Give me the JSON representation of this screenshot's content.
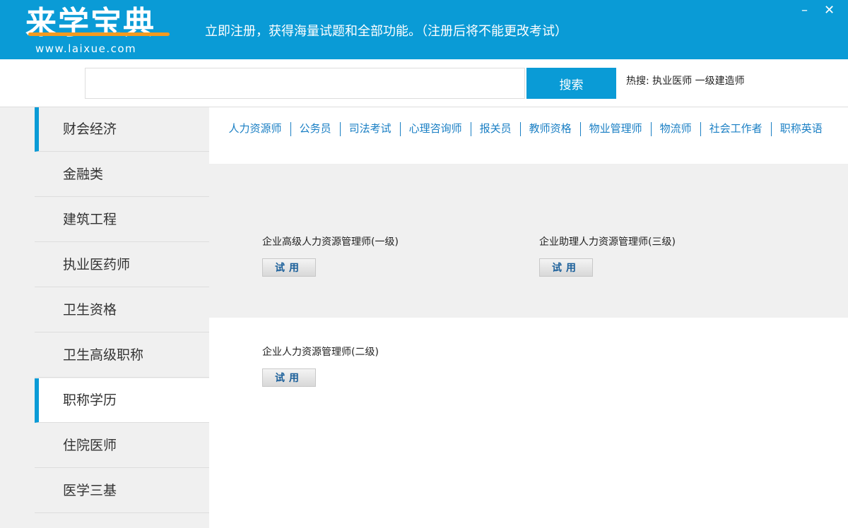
{
  "header": {
    "logo_text": "来学宝典",
    "logo_url": "www.laixue.com",
    "slogan": "立即注册，获得海量试题和全部功能。（注册后将不能更改考试）",
    "minimize": "–",
    "close": "✕"
  },
  "search": {
    "placeholder": "",
    "value": "",
    "button": "搜索",
    "hot": "热搜: 执业医师 一级建造师"
  },
  "sidebar": {
    "items": [
      {
        "label": "财会经济",
        "marked": true,
        "selected": false
      },
      {
        "label": "金融类"
      },
      {
        "label": "建筑工程"
      },
      {
        "label": "执业医药师"
      },
      {
        "label": "卫生资格"
      },
      {
        "label": "卫生高级职称"
      },
      {
        "label": "职称学历",
        "marked": true,
        "selected": true
      },
      {
        "label": "住院医师"
      },
      {
        "label": "医学三基"
      }
    ]
  },
  "tabs": [
    "人力资源师",
    "公务员",
    "司法考试",
    "心理咨询师",
    "报关员",
    "教师资格",
    "物业管理师",
    "物流师",
    "社会工作者",
    "职称英语"
  ],
  "courses": [
    {
      "name": "企业高级人力资源管理师(一级)",
      "button": "试用"
    },
    {
      "name": "企业助理人力资源管理师(三级)",
      "button": "试用"
    },
    {
      "name": "企业人力资源管理师(二级)",
      "button": "试用"
    }
  ],
  "colors": {
    "brand": "#0a9bd6",
    "accent": "#f39a1e",
    "link": "#1a7fc4"
  }
}
